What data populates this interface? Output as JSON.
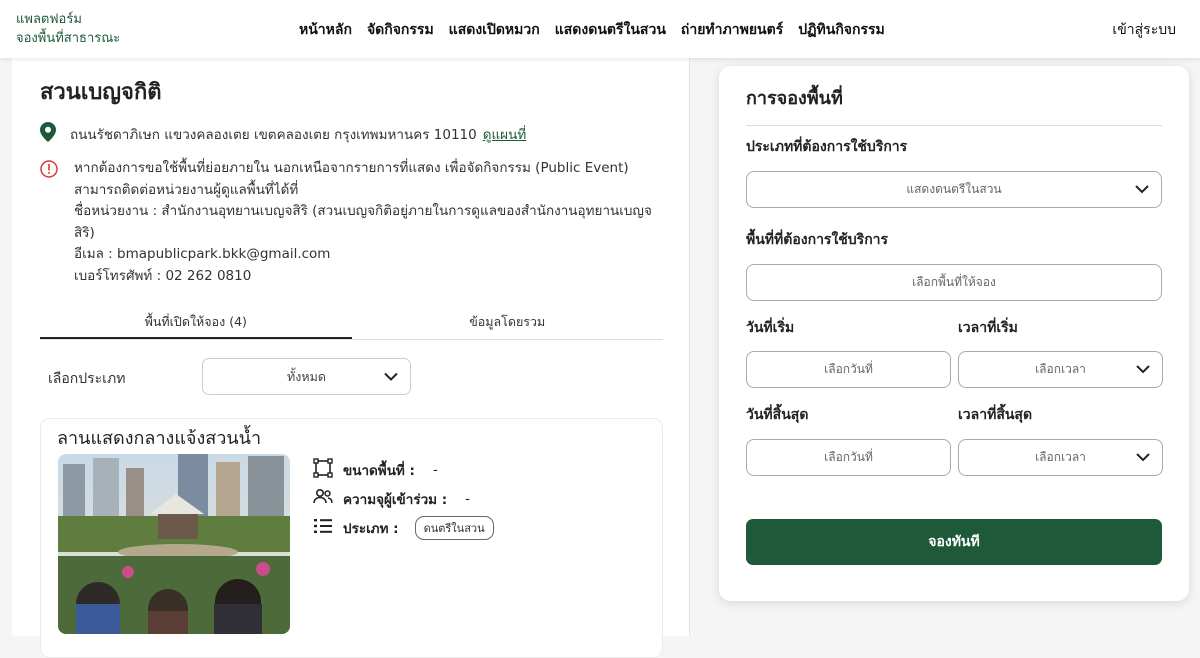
{
  "brand": {
    "line1": "แพลตฟอร์ม",
    "line2": "จองพื้นที่สาธารณะ"
  },
  "nav": [
    {
      "label": "หน้าหลัก"
    },
    {
      "label": "จัดกิจกรรม"
    },
    {
      "label": "แสดงเปิดหมวก"
    },
    {
      "label": "แสดงดนตรีในสวน"
    },
    {
      "label": "ถ่ายทำภาพยนตร์"
    },
    {
      "label": "ปฏิทินกิจกรรม"
    }
  ],
  "login_label": "เข้าสู่ระบบ",
  "park": {
    "name": "สวนเบญจกิติ",
    "address": "ถนนรัชดาภิเษก แขวงคลองเตย เขตคลองเตย กรุงเทพมหานคร 10110",
    "map_link": "ดูแผนที่",
    "info_lines": [
      "หากต้องการขอใช้พื้นที่ย่อยภายใน นอกเหนือจากรายการที่แสดง เพื่อจัดกิจกรรม (Public Event)",
      "สามารถติดต่อหน่วยงานผู้ดูแลพื้นที่ได้ที่",
      "ชื่อหน่วยงาน : สำนักงานอุทยานเบญจสิริ (สวนเบญจกิติอยู่ภายในการดูแลของสำนักงานอุทยานเบญจ",
      "สิริ)",
      "อีเมล : bmapublicpark.bkk@gmail.com",
      "เบอร์โทรศัพท์ : 02 262 0810"
    ]
  },
  "tabs": {
    "open_spaces": "พื้นที่เปิดให้จอง (4)",
    "overview": "ข้อมูลโดยรวม"
  },
  "filter": {
    "label": "เลือกประเภท",
    "value": "ทั้งหมด"
  },
  "venue": {
    "name": "ลานแสดงกลางแจ้งสวนน้ำ",
    "size_label": "ขนาดพื้นที่ :",
    "size_value": "-",
    "capacity_label": "ความจุผู้เข้าร่วม :",
    "capacity_value": "-",
    "type_label": "ประเภท :",
    "type_tag": "ดนตรีในสวน"
  },
  "booking": {
    "title": "การจองพื้นที่",
    "service_type_label": "ประเภทที่ต้องการใช้บริการ",
    "service_type_value": "แสดงดนตรีในสวน",
    "space_label": "พื้นที่ที่ต้องการใช้บริการ",
    "space_placeholder": "เลือกพื้นที่ให้จอง",
    "start_date_label": "วันที่เริ่ม",
    "start_date_placeholder": "เลือกวันที่",
    "start_time_label": "เวลาที่เริ่ม",
    "start_time_placeholder": "เลือกเวลา",
    "end_date_label": "วันที่สิ้นสุด",
    "end_date_placeholder": "เลือกวันที่",
    "end_time_label": "เวลาที่สิ้นสุด",
    "end_time_placeholder": "เลือกเวลา",
    "submit": "จองทันที"
  },
  "colors": {
    "brand_green": "#1e5a3a",
    "info_red": "#d9383a"
  },
  "icons": [
    "map-pin-icon",
    "info-icon",
    "chevron-down-icon",
    "area-size-icon",
    "people-icon",
    "list-icon"
  ]
}
